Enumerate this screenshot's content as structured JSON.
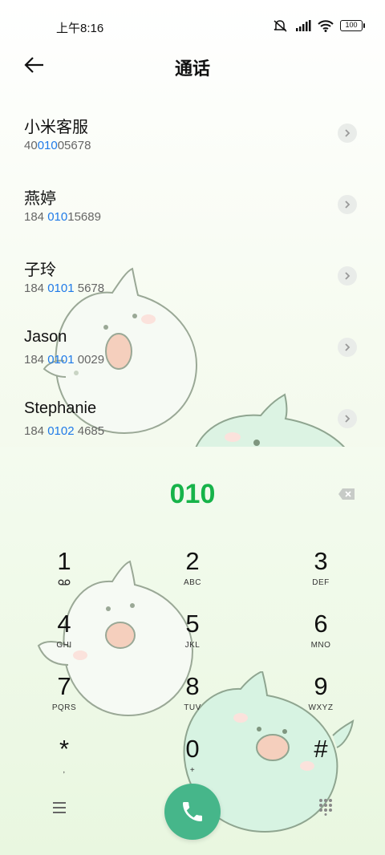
{
  "status_bar": {
    "time": "上午8:16",
    "battery": "100",
    "icons": [
      "mute-icon",
      "signal-icon",
      "wifi-icon",
      "battery-icon"
    ]
  },
  "header": {
    "title": "通话",
    "back_icon": "back-arrow-icon"
  },
  "contacts": [
    {
      "name": "小米客服",
      "number_prefix": "40",
      "number_match": "010",
      "number_suffix": "05678"
    },
    {
      "name": "燕婷",
      "number_prefix": "184 ",
      "number_match": "010",
      "number_suffix": "15689"
    },
    {
      "name": "子玲",
      "number_prefix": "184 ",
      "number_match": "0101",
      "number_suffix": " 5678"
    },
    {
      "name": "Jason",
      "number_prefix": "184 ",
      "number_match": "0101",
      "number_suffix": " 0029"
    },
    {
      "name": "Stephanie",
      "number_prefix": "184 ",
      "number_match": "0102",
      "number_suffix": " 4685"
    }
  ],
  "dialer": {
    "display": "010",
    "keys": [
      {
        "digit": "1",
        "letters": ""
      },
      {
        "digit": "2",
        "letters": "ABC"
      },
      {
        "digit": "3",
        "letters": "DEF"
      },
      {
        "digit": "4",
        "letters": "GHI"
      },
      {
        "digit": "5",
        "letters": "JKL"
      },
      {
        "digit": "6",
        "letters": "MNO"
      },
      {
        "digit": "7",
        "letters": "PQRS"
      },
      {
        "digit": "8",
        "letters": "TUV"
      },
      {
        "digit": "9",
        "letters": "WXYZ"
      },
      {
        "digit": "*",
        "letters": ","
      },
      {
        "digit": "0",
        "letters": "+"
      },
      {
        "digit": "#",
        "letters": ""
      }
    ]
  },
  "colors": {
    "accent_green": "#17b34a",
    "call_button": "#46b68a",
    "match_blue": "#1f7ae8"
  }
}
